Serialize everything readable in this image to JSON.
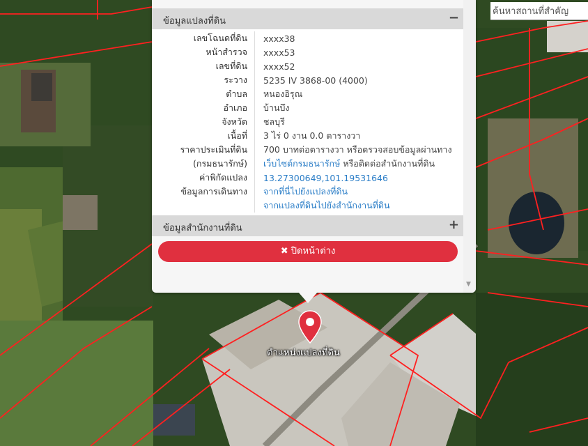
{
  "search": {
    "label": "ค้นหาสถานที่สำคัญ"
  },
  "popup": {
    "section_parcel": {
      "title": "ข้อมูลแปลงที่ดิน",
      "toggle": "−"
    },
    "rows": [
      {
        "label": "เลขโฉนดที่ดิน",
        "value": "xxxx38"
      },
      {
        "label": "หน้าสำรวจ",
        "value": "xxxx53"
      },
      {
        "label": "เลขที่ดิน",
        "value": "xxxx52"
      },
      {
        "label": "ระวาง",
        "value": "5235 IV 3868-00 (4000)"
      },
      {
        "label": "ตำบล",
        "value": "หนองอิรุณ"
      },
      {
        "label": "อำเภอ",
        "value": "บ้านบึง"
      },
      {
        "label": "จังหวัด",
        "value": "ชลบุรี"
      },
      {
        "label": "เนื้อที่",
        "value": "3 ไร่ 0 งาน 0.0 ตารางวา"
      }
    ],
    "price": {
      "label1": "ราคาประเมินที่ดิน",
      "value1": "700 บาทต่อตารางวา หรือตรวจสอบข้อมูลผ่านทาง",
      "label2": "(กรมธนารักษ์)",
      "link": "เว็บไซต์กรมธนารักษ์",
      "value2": " หรือติดต่อสำนักงานที่ดิน"
    },
    "coords": {
      "label": "ค่าพิกัดแปลง",
      "value": "13.27300649,101.19531646"
    },
    "travel": {
      "label": "ข้อมูลการเดินทาง",
      "link1": "จากที่นี่ไปยังแปลงที่ดิน",
      "link2": "จากแปลงที่ดินไปยังสำนักงานที่ดิน"
    },
    "section_office": {
      "title": "ข้อมูลสำนักงานที่ดิน",
      "toggle": "+"
    },
    "close_button": {
      "icon": "✖",
      "label": "ปิดหน้าต่าง"
    }
  },
  "marker": {
    "label": "ตำแหน่งแปลงที่ดิน",
    "color": "#e0303f"
  },
  "colors": {
    "boundary": "#ff2020",
    "accent": "#e0303f",
    "link": "#2a7dc7"
  }
}
